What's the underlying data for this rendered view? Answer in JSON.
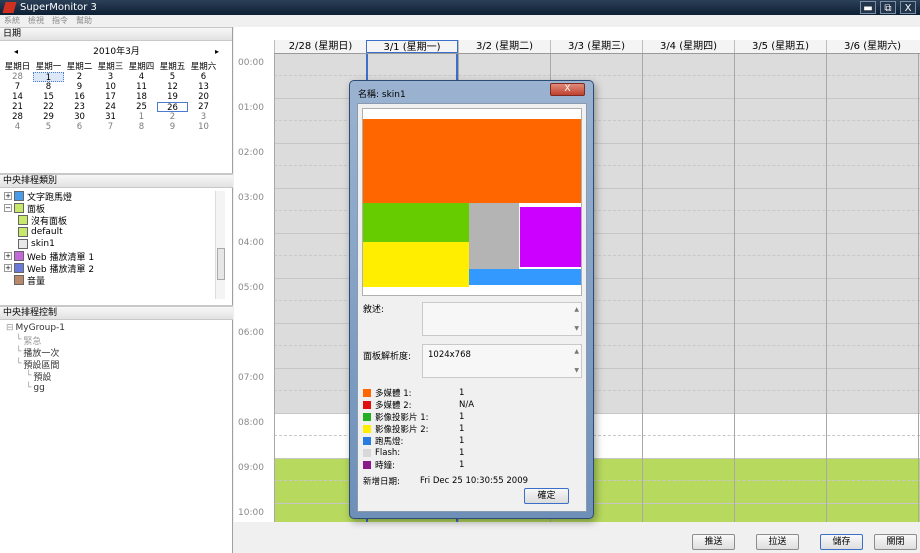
{
  "window": {
    "title": "SuperMonitor 3",
    "min": "▬",
    "max": "⧉",
    "close": "X"
  },
  "menu": [
    "系統",
    "檢視",
    "指令",
    "幫助"
  ],
  "calendar": {
    "header": "日期",
    "month_label": "2010年3月",
    "prev": "◂",
    "next": "▸",
    "weekdays": [
      "星期日",
      "星期一",
      "星期二",
      "星期三",
      "星期四",
      "星期五",
      "星期六"
    ],
    "weeks": [
      [
        "28",
        "1",
        "2",
        "3",
        "4",
        "5",
        "6"
      ],
      [
        "7",
        "8",
        "9",
        "10",
        "11",
        "12",
        "13"
      ],
      [
        "14",
        "15",
        "16",
        "17",
        "18",
        "19",
        "20"
      ],
      [
        "21",
        "22",
        "23",
        "24",
        "25",
        "26",
        "27"
      ],
      [
        "28",
        "29",
        "30",
        "31",
        "1",
        "2",
        "3"
      ],
      [
        "4",
        "5",
        "6",
        "7",
        "8",
        "9",
        "10"
      ]
    ]
  },
  "categories": {
    "header": "中央排程類別",
    "items": [
      {
        "label": "文字跑馬燈",
        "color": "#4a9be8",
        "level": 0,
        "expander": "+"
      },
      {
        "label": "面板",
        "color": "#c7e86a",
        "level": 0,
        "expander": "−"
      },
      {
        "label": "沒有面板",
        "color": "#c7e86a",
        "level": 1
      },
      {
        "label": "default",
        "color": "#c7e86a",
        "level": 1
      },
      {
        "label": "skin1",
        "color": "#e8e8e8",
        "level": 1
      },
      {
        "label": "Web 播放清單 1",
        "color": "#c46ad8",
        "level": 0,
        "expander": "+"
      },
      {
        "label": "Web 播放清單 2",
        "color": "#6a7bd8",
        "level": 0,
        "expander": "+"
      },
      {
        "label": "音量",
        "color": "#b98a6a",
        "level": 0
      }
    ]
  },
  "control": {
    "header": "中央排程控制",
    "items": [
      {
        "label": "MyGroup-1",
        "level": 0,
        "dim": false
      },
      {
        "label": "緊急",
        "level": 1,
        "dim": true
      },
      {
        "label": "播放一次",
        "level": 1,
        "dim": false
      },
      {
        "label": "預設區間",
        "level": 1,
        "dim": false
      },
      {
        "label": "預設",
        "level": 2,
        "dim": false
      },
      {
        "label": "gg",
        "level": 2,
        "dim": false
      }
    ]
  },
  "schedule": {
    "days": [
      "2/28 (星期日)",
      "3/1 (星期一)",
      "3/2 (星期二)",
      "3/3 (星期三)",
      "3/4 (星期四)",
      "3/5 (星期五)",
      "3/6 (星期六)"
    ],
    "times": [
      "00:00",
      "01:00",
      "02:00",
      "03:00",
      "04:00",
      "05:00",
      "06:00",
      "07:00",
      "08:00",
      "09:00",
      "10:00"
    ],
    "colors": {
      "past": "#dcdcdc",
      "free": "#ffffff",
      "booked": "#b6d95e",
      "selection": "#3b6fc8"
    }
  },
  "buttons": {
    "push": "推送",
    "pull": "拉送",
    "save": "儲存",
    "close": "關閉"
  },
  "dialog": {
    "title": "名稱: skin1",
    "close": "X",
    "description_label": "敘述:",
    "resolution_label": "面板解析度:",
    "resolution_value": "1024x768",
    "legend": [
      {
        "label": "多媒體 1:",
        "value": "1",
        "color": "#ff6600"
      },
      {
        "label": "多媒體 2:",
        "value": "N/A",
        "color": "#e01010"
      },
      {
        "label": "影像投影片 1:",
        "value": "1",
        "color": "#22b022"
      },
      {
        "label": "影像投影片 2:",
        "value": "1",
        "color": "#ffee00"
      },
      {
        "label": "跑馬燈:",
        "value": "1",
        "color": "#2a7be0"
      },
      {
        "label": "Flash:",
        "value": "1",
        "color": "#d8d8d8"
      },
      {
        "label": "時鐘:",
        "value": "1",
        "color": "#8a1a8a"
      }
    ],
    "created_label": "新增日期:",
    "created_value": "Fri Dec 25 10:30:55 2009",
    "ok": "確定"
  }
}
